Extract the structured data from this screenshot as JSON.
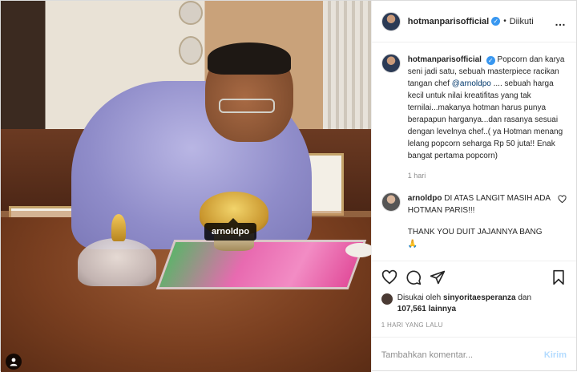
{
  "header": {
    "username": "hotmanparisofficial",
    "separator": "•",
    "follow_status": "Diikuti",
    "more_icon": "…"
  },
  "photo": {
    "tag_label": "arnoldpo"
  },
  "caption": {
    "username": "hotmanparisofficial",
    "text_before": "Popcorn dan karya seni jadi satu, sebuah masterpiece racikan tangan chef ",
    "mention": "@arnoldpo",
    "text_after": " .... sebuah harga kecil untuk nilai kreatifitas yang tak ternilai...makanya hotman harus punya berapapun harganya...dan rasanya sesuai dengan levelnya chef..( ya Hotman menang lelang popcorn seharga Rp 50 juta!! Enak bangat pertama popcorn)",
    "time": "1 hari"
  },
  "comment": {
    "username": "arnoldpo",
    "text": "DI ATAS LANGIT MASIH ADA HOTMAN PARIS!!!",
    "reply": "THANK YOU DUIT JAJANNYA BANG 🙏"
  },
  "likes": {
    "prefix": "Disukai oleh",
    "user": "sinyoritaesperanza",
    "middle": "dan",
    "count": "107,561",
    "suffix": "lainnya"
  },
  "date": "1 HARI YANG LALU",
  "add_comment": {
    "placeholder": "Tambahkan komentar...",
    "post_label": "Kirim"
  },
  "colors": {
    "link": "#00376b",
    "verified": "#3897f0",
    "post_disabled": "#b3dbff"
  }
}
